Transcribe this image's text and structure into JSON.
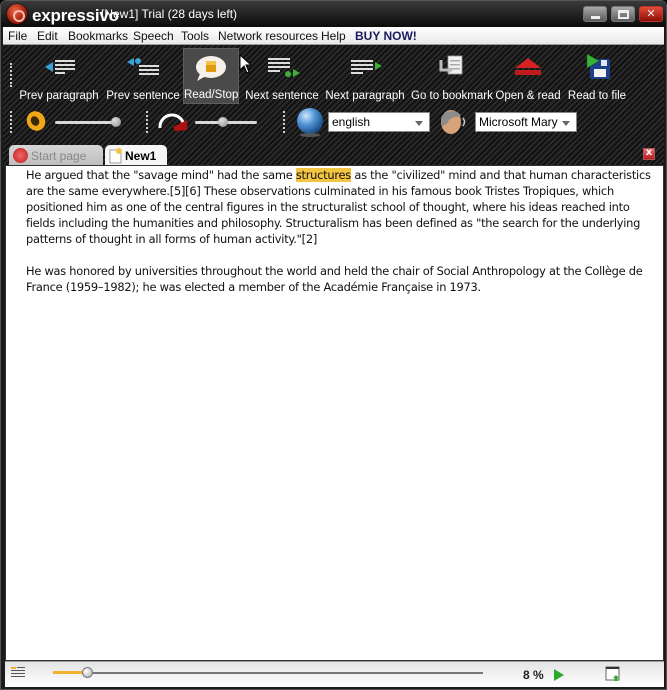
{
  "window": {
    "app_name": "expressivo",
    "title": "[New1] Trial (28 days left)",
    "controls": {
      "minimize": "minimize",
      "maximize": "maximize",
      "close": "close"
    }
  },
  "menu": [
    {
      "label": "File",
      "id": "file"
    },
    {
      "label": "Edit",
      "id": "edit"
    },
    {
      "label": "Bookmarks",
      "id": "bookmarks"
    },
    {
      "label": "Speech",
      "id": "speech"
    },
    {
      "label": "Tools",
      "id": "tools"
    },
    {
      "label": "Network resources",
      "id": "network-resources"
    },
    {
      "label": "Help",
      "id": "help"
    },
    {
      "label": "BUY NOW!",
      "id": "buy-now"
    }
  ],
  "toolbar": {
    "buttons": [
      {
        "label": "Prev paragraph",
        "icon": "prev-paragraph-icon"
      },
      {
        "label": "Prev sentence",
        "icon": "prev-sentence-icon"
      },
      {
        "label": "Read/Stop",
        "icon": "speech-bubble-icon",
        "active": true
      },
      {
        "label": "Next sentence",
        "icon": "next-sentence-icon"
      },
      {
        "label": "Next paragraph",
        "icon": "next-paragraph-icon"
      },
      {
        "label": "Go to bookmark",
        "icon": "bookmark-icon"
      },
      {
        "label": "Open & read",
        "icon": "eject-icon"
      },
      {
        "label": "Read to file",
        "icon": "save-file-icon"
      }
    ],
    "volume": {
      "icon": "speaker-icon",
      "level_percent": 95
    },
    "speed": {
      "icon": "speedometer-icon",
      "level_percent": 45
    },
    "language": {
      "icon": "globe-icon",
      "value": "english"
    },
    "voice": {
      "icon": "speaking-head-icon",
      "value": "Microsoft Mary"
    }
  },
  "tabs": [
    {
      "label": "Start page",
      "icon": "expressivo-logo-icon",
      "active": false
    },
    {
      "label": "New1",
      "icon": "document-icon",
      "active": true
    }
  ],
  "tab_close": "x",
  "document": {
    "p1_before": "He argued that the \"savage mind\" had the same ",
    "p1_highlight": "structures",
    "p1_after": " as the \"civilized\" mind and that human characteristics are the same everywhere.[5][6] These observations culminated in his famous book Tristes Tropiques, which positioned him as one of the central figures in the structuralist school of thought, where his ideas reached into fields including the humanities and philosophy. Structuralism has been defined as \"the search for the underlying patterns of thought in all forms of human activity.\"[2]",
    "p2": "He was honored by universities throughout the world and held the chair of Social Anthropology at the Collège de France (1959–1982); he was elected a member of the Académie Française in 1973."
  },
  "statusbar": {
    "progress_percent": 8,
    "progress_label": "8 %",
    "colors": {
      "progress": "#f0b030",
      "play": "#2ea82e"
    }
  },
  "colors": {
    "highlight": "#f4c542",
    "accent_red": "#c0201a"
  }
}
